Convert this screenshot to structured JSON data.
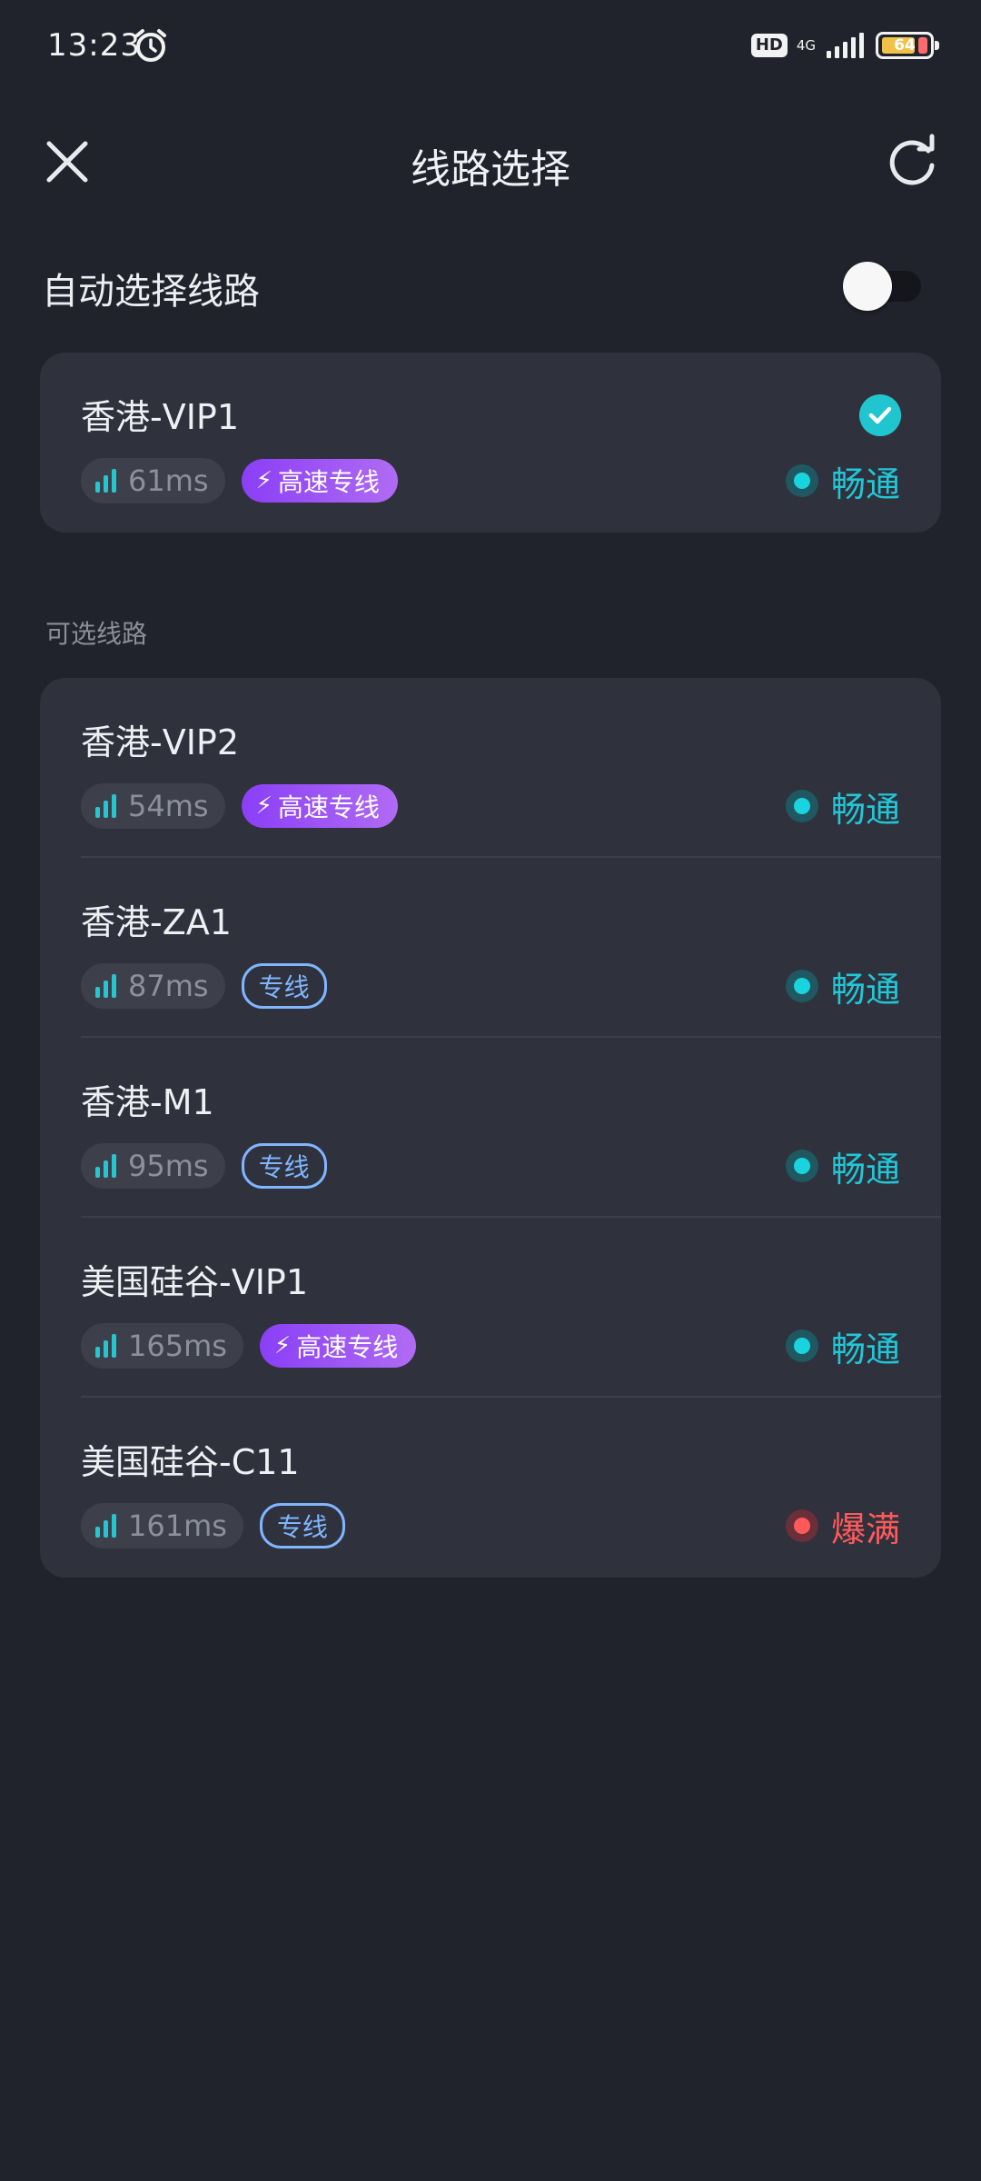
{
  "status_bar": {
    "time": "13:23",
    "hd": "HD",
    "network": "4G",
    "battery": "64"
  },
  "header": {
    "title": "线路选择"
  },
  "auto_select": {
    "label": "自动选择线路",
    "enabled": false
  },
  "selected_route": {
    "name": "香港-VIP1",
    "latency": "61ms",
    "tag": "高速专线",
    "tag_type": "fast",
    "status": "畅通",
    "status_type": "ok"
  },
  "section_label": "可选线路",
  "routes": [
    {
      "name": "香港-VIP2",
      "latency": "54ms",
      "tag": "高速专线",
      "tag_type": "fast",
      "status": "畅通",
      "status_type": "ok"
    },
    {
      "name": "香港-ZA1",
      "latency": "87ms",
      "tag": "专线",
      "tag_type": "line",
      "status": "畅通",
      "status_type": "ok"
    },
    {
      "name": "香港-M1",
      "latency": "95ms",
      "tag": "专线",
      "tag_type": "line",
      "status": "畅通",
      "status_type": "ok"
    },
    {
      "name": "美国硅谷-VIP1",
      "latency": "165ms",
      "tag": "高速专线",
      "tag_type": "fast",
      "status": "畅通",
      "status_type": "ok"
    },
    {
      "name": "美国硅谷-C11",
      "latency": "161ms",
      "tag": "专线",
      "tag_type": "line",
      "status": "爆满",
      "status_type": "full"
    }
  ],
  "colors": {
    "background": "#21232c",
    "card": "#2f313d",
    "accent_cyan": "#22c6d6",
    "fast_tag": "#9b55f5",
    "line_tag": "#7fb6ff",
    "full_red": "#ff5a5a"
  }
}
